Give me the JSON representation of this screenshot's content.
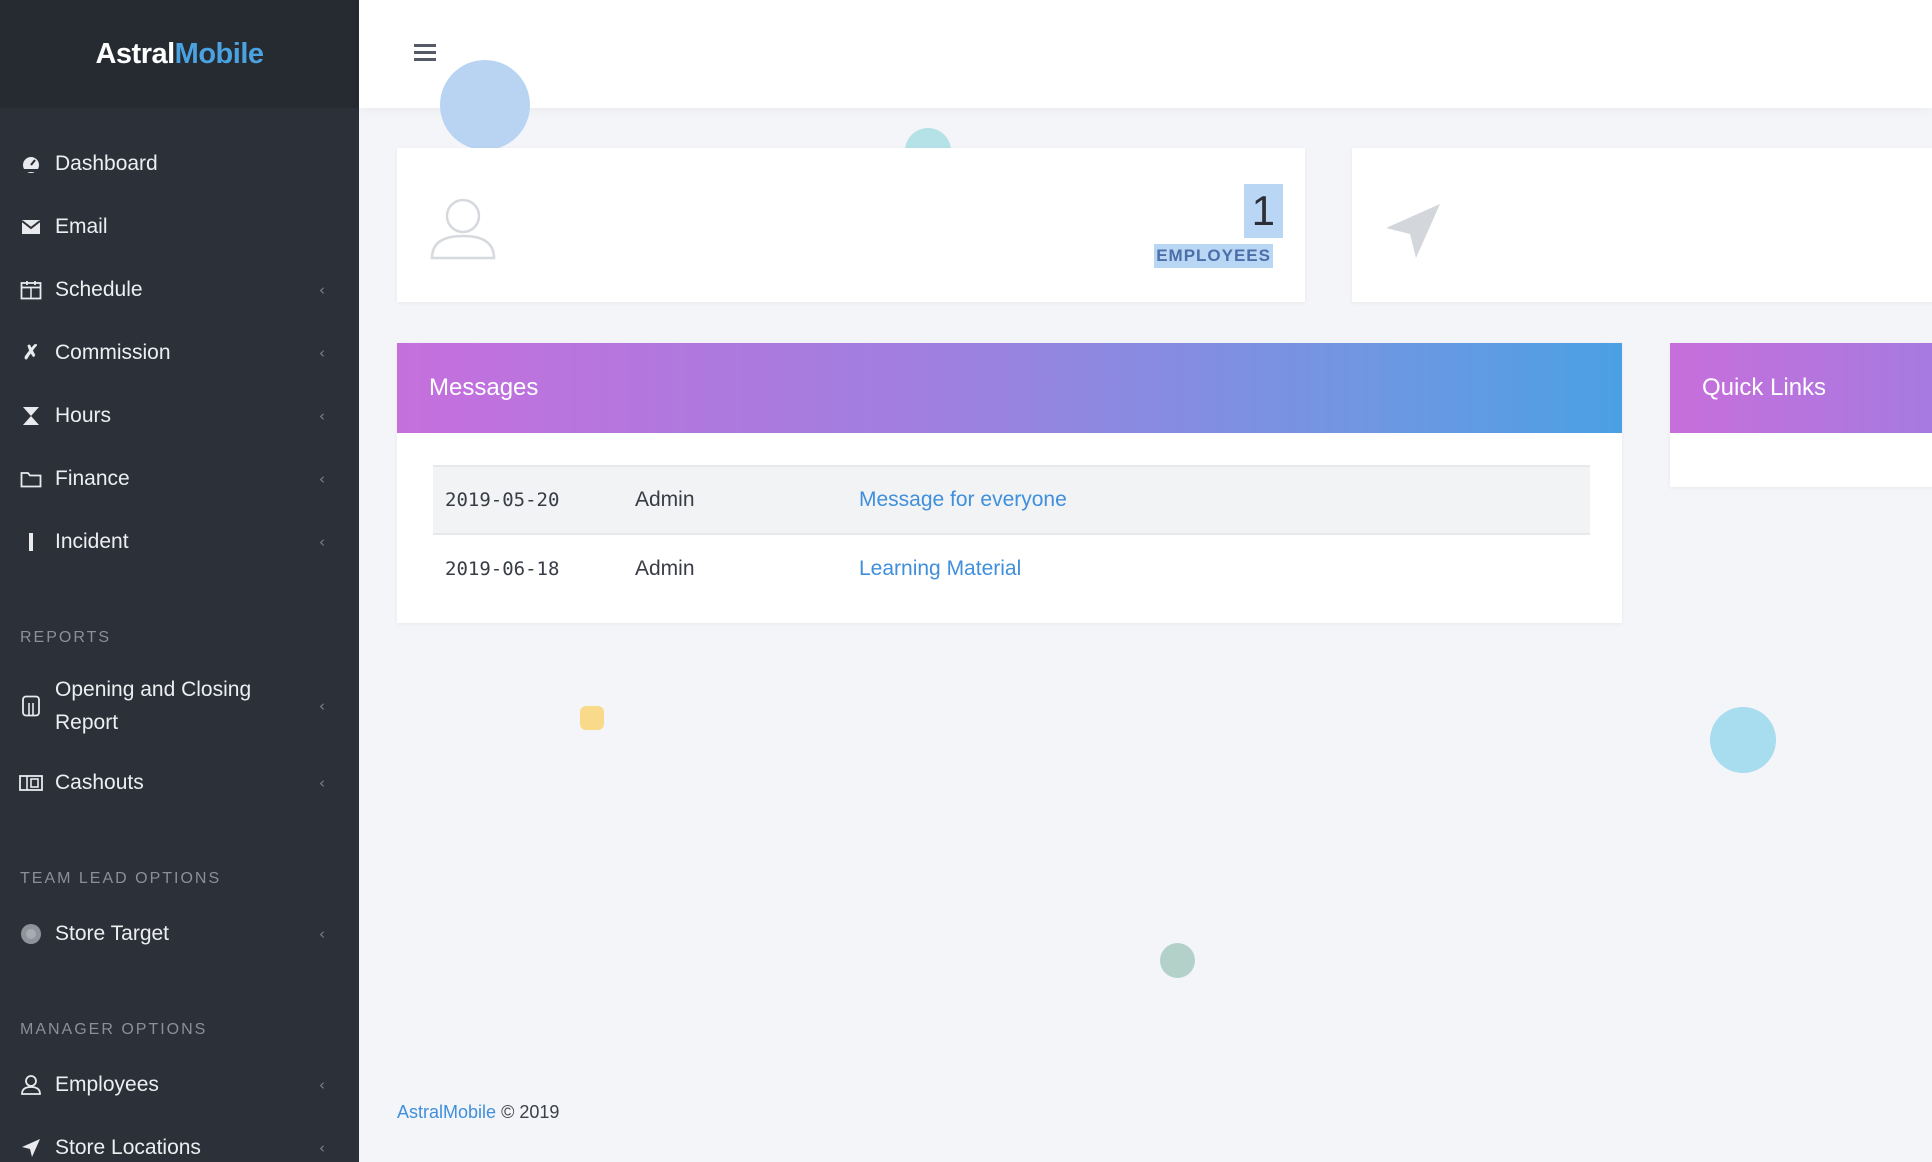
{
  "brand": {
    "part1": "Astral",
    "part2": "Mobile"
  },
  "sidebar": {
    "items": [
      {
        "label": "Dashboard",
        "icon": "dashboard-icon",
        "has_submenu": false
      },
      {
        "label": "Email",
        "icon": "email-icon",
        "has_submenu": false
      },
      {
        "label": "Schedule",
        "icon": "calendar-icon",
        "has_submenu": true
      },
      {
        "label": "Commission",
        "icon": "commission-icon",
        "has_submenu": true
      },
      {
        "label": "Hours",
        "icon": "hourglass-icon",
        "has_submenu": true
      },
      {
        "label": "Finance",
        "icon": "folder-icon",
        "has_submenu": true
      },
      {
        "label": "Incident",
        "icon": "exclamation-icon",
        "has_submenu": true
      }
    ],
    "sections": [
      {
        "title": "REPORTS",
        "items": [
          {
            "label": "Opening and Closing Report",
            "icon": "report-icon",
            "has_submenu": true
          },
          {
            "label": "Cashouts",
            "icon": "cash-icon",
            "has_submenu": true
          }
        ]
      },
      {
        "title": "TEAM LEAD OPTIONS",
        "items": [
          {
            "label": "Store Target",
            "icon": "target-icon",
            "has_submenu": true
          }
        ]
      },
      {
        "title": "MANAGER OPTIONS",
        "items": [
          {
            "label": "Employees",
            "icon": "employees-icon",
            "has_submenu": true
          },
          {
            "label": "Store Locations",
            "icon": "location-icon",
            "has_submenu": true
          }
        ]
      }
    ],
    "chevron": "‹"
  },
  "stats": {
    "employees": {
      "value": "1",
      "label": "EMPLOYEES",
      "icon": "user-icon"
    },
    "locations": {
      "icon": "location-arrow-icon"
    }
  },
  "messages": {
    "title": "Messages",
    "rows": [
      {
        "date": "2019-05-20",
        "author": "Admin",
        "subject": "Message for everyone"
      },
      {
        "date": "2019-06-18",
        "author": "Admin",
        "subject": "Learning Material"
      }
    ]
  },
  "quick_links": {
    "title": "Quick Links"
  },
  "footer": {
    "brand": "AstralMobile",
    "copyright": "© 2019"
  },
  "colors": {
    "sidebar_bg": "#2c3038",
    "brand_accent": "#4aa3e0",
    "link": "#3f8fdc",
    "header_gradient_start": "#c56fdd",
    "header_gradient_end": "#4aa0e4"
  }
}
